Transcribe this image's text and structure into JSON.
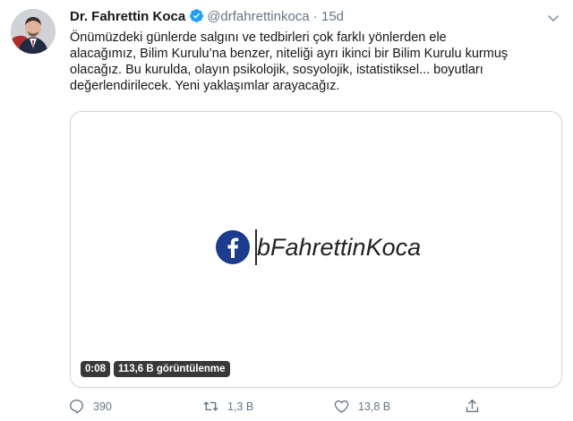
{
  "tweet": {
    "author_name": "Dr. Fahrettin Koca",
    "handle": "@drfahrettinkoca",
    "separator": "·",
    "time": "15d",
    "text_lines": [
      "Önümüzdeki günlerde salgını ve tedbirleri çok farklı yönlerden ele",
      "alacağımız, Bilim Kurulu’na benzer, niteliği ayrı ikinci bir Bilim Kurulu kurmuş",
      "olacağız. Bu kurulda, olayın psikolojik, sosyolojik, istatistiksel... boyutları",
      "değerlendirilecek. Yeni yaklaşımlar arayacağız."
    ]
  },
  "media": {
    "facebook_handle": "bFahrettinKoca",
    "video_time": "0:08",
    "view_count": "113,6 B görüntülenme"
  },
  "actions": {
    "reply_count": "390",
    "retweet_count": "1,3 B",
    "like_count": "13,8 B"
  },
  "colors": {
    "verified_blue": "#1da1f2",
    "facebook_blue": "#1c3d8f",
    "muted_text": "#657786"
  },
  "icons": [
    "verified-badge-icon",
    "caret-down-icon",
    "facebook-icon",
    "reply-icon",
    "retweet-icon",
    "like-icon",
    "share-icon"
  ]
}
